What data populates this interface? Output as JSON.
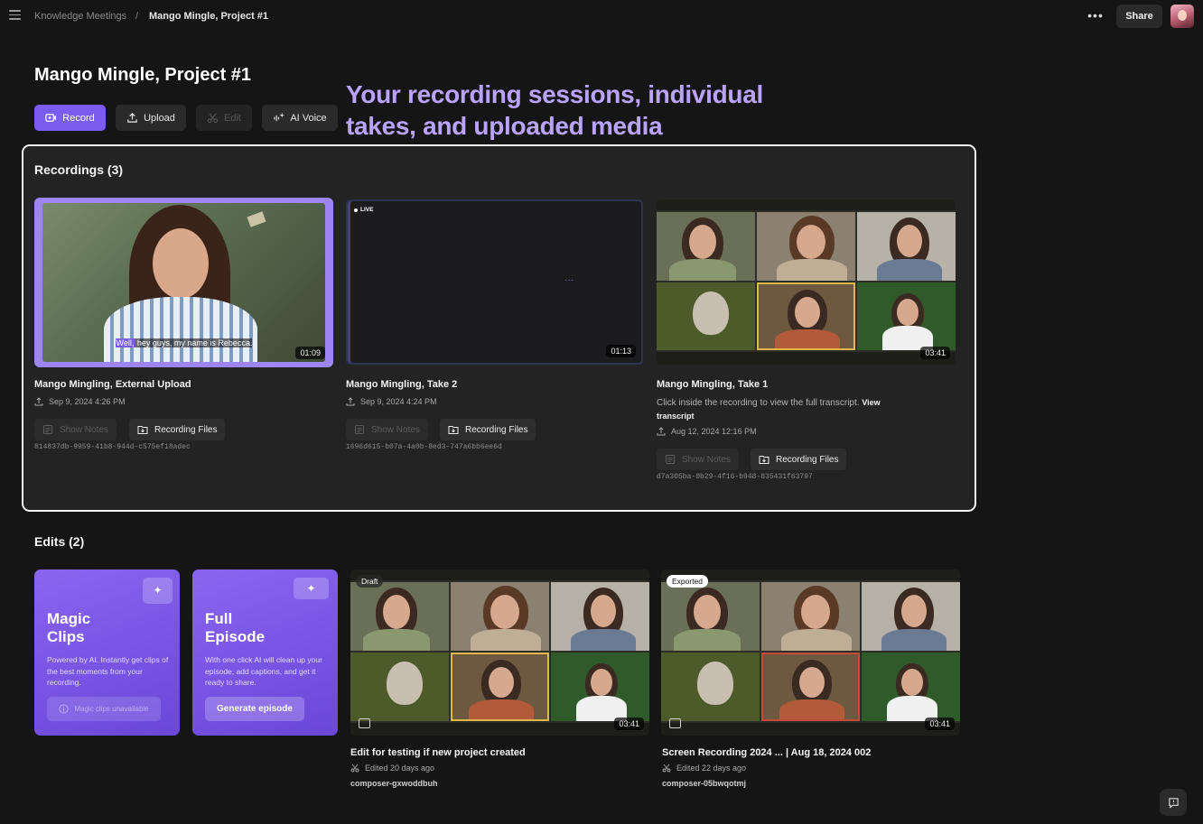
{
  "breadcrumb": {
    "root": "Knowledge Meetings",
    "separator": "/",
    "current": "Mango Mingle, Project #1"
  },
  "header": {
    "more": "•••",
    "share_label": "Share"
  },
  "page_title": "Mango Mingle, Project #1",
  "toolbar": {
    "record_label": "Record",
    "upload_label": "Upload",
    "edit_label": "Edit",
    "ai_voice_label": "AI Voice"
  },
  "callout": {
    "line1": "Your recording sessions, individual",
    "line2": "takes, and uploaded media"
  },
  "recordings": {
    "title": "Recordings (3)",
    "items": [
      {
        "title": "Mango Mingling, External Upload",
        "date": "Sep 9, 2024 4:26 PM",
        "duration": "01:09",
        "caption_highlight": "Well,",
        "caption_rest": " hey guys, my name is Rebecca.",
        "show_notes_label": "Show Notes",
        "files_label": "Recording Files",
        "id": "814837db-9959-41b8-944d-c575ef18adec"
      },
      {
        "title": "Mango Mingling, Take 2",
        "date": "Sep 9, 2024 4:24 PM",
        "duration": "01:13",
        "live_label": "LIVE",
        "show_notes_label": "Show Notes",
        "files_label": "Recording Files",
        "id": "1696d615-b07a-4a0b-8ed3-747a6bb6ee6d"
      },
      {
        "title": "Mango Mingling, Take 1",
        "desc": "Click inside the recording to view the full transcript.",
        "desc_link": "View transcript",
        "date": "Aug 12, 2024 12:16 PM",
        "duration": "03:41",
        "show_notes_label": "Show Notes",
        "files_label": "Recording Files",
        "id": "d7a305ba-0b29-4f16-b948-835431f63797"
      }
    ]
  },
  "edits": {
    "title": "Edits (2)",
    "magic_clips": {
      "title_line1": "Magic",
      "title_line2": "Clips",
      "desc": "Powered by AI. Instantly get clips of the best moments from your recording.",
      "button_label": "Magic clips unavailable"
    },
    "full_episode": {
      "title_line1": "Full",
      "title_line2": "Episode",
      "desc": "With one click AI will clean up your episode, add captions, and get it ready to share.",
      "button_label": "Generate episode"
    },
    "items": [
      {
        "badge": "Draft",
        "title": "Edit for testing if new project created",
        "edited": "Edited 20 days ago",
        "composer": "composer-gxwoddbuh",
        "duration": "03:41"
      },
      {
        "badge": "Exported",
        "title": "Screen Recording 2024 ... | Aug 18, 2024 002",
        "edited": "Edited 22 days ago",
        "composer": "composer-05bwqotmj",
        "duration": "03:41"
      }
    ]
  },
  "colors": {
    "accent": "#7b5cf0",
    "callout": "#b9a3ff",
    "background": "#151515",
    "panel": "#232323"
  }
}
